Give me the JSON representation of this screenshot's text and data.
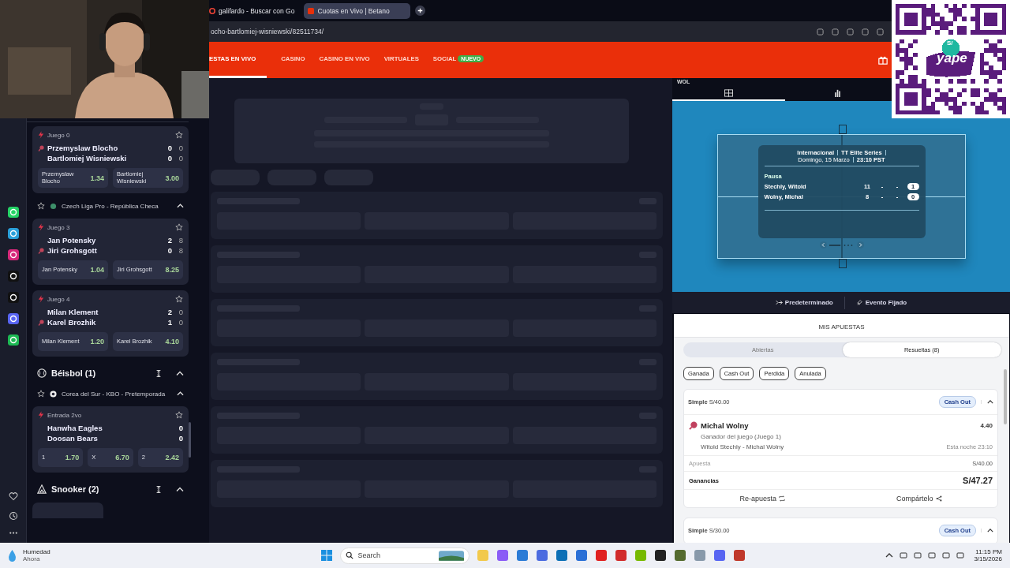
{
  "qr_overlay": {
    "badge": "S/",
    "logo": "yape"
  },
  "browser": {
    "tabs": [
      {
        "title": "galifardo - Buscar con Go",
        "selected": false
      },
      {
        "title": "Cuotas en Vivo | Betano",
        "selected": true
      }
    ],
    "address": "ocho-bartlomiej-wisniewski/82511734/"
  },
  "site_nav": {
    "items": [
      {
        "label": "ESTAS EN VIVO",
        "selected": true
      },
      {
        "label": "CASINO",
        "selected": false
      },
      {
        "label": "CASINO EN VIVO",
        "selected": false
      },
      {
        "label": "VIRTUALES",
        "selected": false
      },
      {
        "label": "SOCIAL",
        "selected": false,
        "badge": "NUEVO"
      }
    ]
  },
  "sidebar": {
    "items": [
      {
        "kind": "event",
        "label": "Juego 0",
        "players": [
          {
            "name": "Przemyslaw Blocho",
            "serving": true,
            "scores": [
              "0",
              "0"
            ]
          },
          {
            "name": "Bartlomiej Wisniewski",
            "serving": false,
            "scores": [
              "0",
              "0"
            ]
          }
        ],
        "odds": [
          {
            "label": "Przemyslaw Blocho",
            "value": "1.34"
          },
          {
            "label": "Bartlomiej Wisniewski",
            "value": "3.00"
          }
        ]
      },
      {
        "kind": "league",
        "label": "Czech Liga Pro - República Checa",
        "expanded": true
      },
      {
        "kind": "event",
        "label": "Juego 3",
        "players": [
          {
            "name": "Jan Potensky",
            "serving": false,
            "scores": [
              "2",
              "8"
            ]
          },
          {
            "name": "Jiri Grohsgott",
            "serving": true,
            "scores": [
              "0",
              "8"
            ]
          }
        ],
        "odds": [
          {
            "label": "Jan Potensky",
            "value": "1.04"
          },
          {
            "label": "Jiri Grohsgott",
            "value": "8.25"
          }
        ]
      },
      {
        "kind": "event",
        "label": "Juego 4",
        "players": [
          {
            "name": "Milan Klement",
            "serving": false,
            "scores": [
              "2",
              "0"
            ]
          },
          {
            "name": "Karel Brozhik",
            "serving": true,
            "scores": [
              "1",
              "0"
            ]
          }
        ],
        "odds": [
          {
            "label": "Milan Klement",
            "value": "1.20"
          },
          {
            "label": "Karel Brozhik",
            "value": "4.10"
          }
        ]
      },
      {
        "kind": "sport",
        "label": "Béisbol (1)",
        "expanded": true
      },
      {
        "kind": "league",
        "label": "Corea del Sur - KBO - Pretemporada",
        "expanded": true
      },
      {
        "kind": "event",
        "label": "Entrada 2vo",
        "players": [
          {
            "name": "Hanwha Eagles",
            "serving": false,
            "scores": [
              "0"
            ]
          },
          {
            "name": "Doosan Bears",
            "serving": false,
            "scores": [
              "0"
            ]
          }
        ],
        "odds": [
          {
            "label": "1",
            "value": "1.70"
          },
          {
            "label": "X",
            "value": "6.70"
          },
          {
            "label": "2",
            "value": "2.42"
          }
        ]
      },
      {
        "kind": "sport",
        "label": "Snooker (2)",
        "expanded": true
      }
    ]
  },
  "live_panel": {
    "header": "WOL",
    "tabs": [
      {
        "kind": "field",
        "selected": true
      },
      {
        "kind": "stats",
        "selected": false
      }
    ],
    "scoreboard": {
      "competition": [
        "Internacional",
        "TT Elite Series"
      ],
      "date": [
        "Domingo, 15 Marzo",
        "23:10 PST"
      ],
      "status": "Pausa",
      "players": [
        {
          "name": "Stechly, Witold",
          "cells": [
            "11",
            "-",
            "-"
          ],
          "sets": "1"
        },
        {
          "name": "Wolny, Michal",
          "cells": [
            "8",
            "-",
            "-"
          ],
          "sets": "0"
        }
      ]
    },
    "view_buttons": [
      "Predeterminado",
      "Evento Fijado"
    ]
  },
  "my_bets": {
    "title": "MIS APUESTAS",
    "tabs": [
      {
        "label": "Abiertas",
        "selected": false
      },
      {
        "label": "Resueltas (8)",
        "selected": true
      }
    ],
    "filters": [
      "Ganada",
      "Cash Out",
      "Perdida",
      "Anulada"
    ],
    "bets": [
      {
        "type": "Simple",
        "stake": "S/40.00",
        "badge": "Cash Out",
        "expanded": true,
        "selection": "Michal Wolny",
        "odds": "4.40",
        "market": "Ganador del juego (Juego 1)",
        "event": "Witold Stechly - Michal Wolny",
        "time": "Esta noche 23:10",
        "stake_label": "Apuesta",
        "stake_value": "S/40.00",
        "winnings_label": "Ganancias",
        "winnings": "S/47.27",
        "actions": [
          "Re-apuesta",
          "Compártelo"
        ]
      },
      {
        "type": "Simple",
        "stake": "S/30.00",
        "badge": "Cash Out",
        "expanded": true
      }
    ]
  },
  "taskbar": {
    "weather": {
      "title": "Humedad",
      "subtitle": "Ahora"
    },
    "search": {
      "placeholder": "Search"
    },
    "clock": {
      "time": "11:15 PM",
      "date": "3/15/2026"
    }
  }
}
